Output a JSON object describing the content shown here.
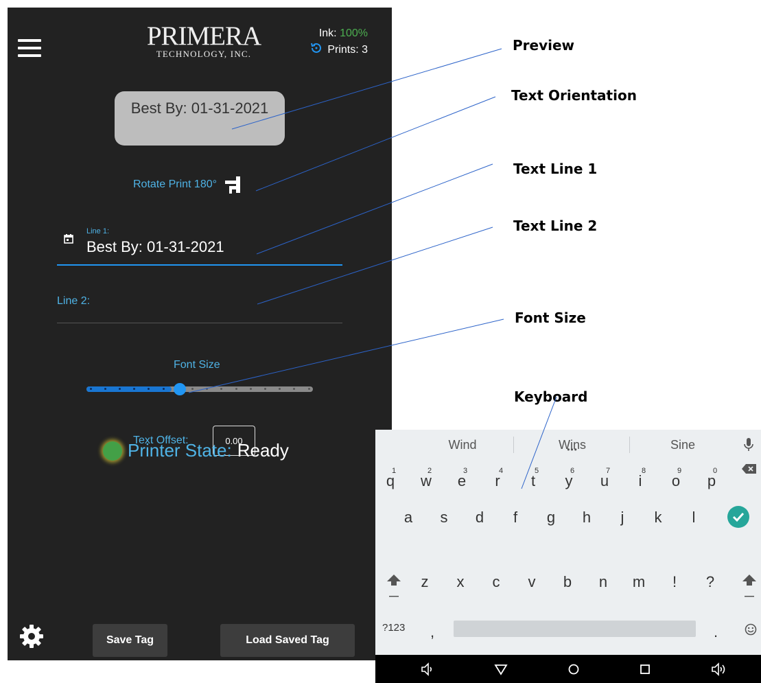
{
  "app": {
    "logo_main": "PRIMERA",
    "logo_sub": "TECHNOLOGY, INC.",
    "ink_label": "Ink:",
    "ink_value": "100%",
    "prints_label": "Prints: 3",
    "preview_text": "Best By: 01-31-2021",
    "rotate_label": "Rotate Print 180°",
    "line1_label": "Line 1:",
    "line1_value": "Best By: 01-31-2021",
    "line2_label": "Line 2:",
    "font_size_label": "Font Size",
    "font_size_level": 0.375,
    "text_offset_label": "Text Offset:",
    "text_offset_value": "0.00",
    "printer_state_label": "Printer State:",
    "printer_state_value": "Ready",
    "save_button": "Save Tag",
    "load_button": "Load Saved Tag",
    "colors": {
      "accent": "#4fb3e6",
      "ink": "#4caf50",
      "state_dot": "#43a047",
      "background": "#222222"
    }
  },
  "annotations": {
    "preview": "Preview",
    "text_orientation": "Text Orientation",
    "text_line_1": "Text Line 1",
    "text_line_2": "Text Line 2",
    "font_size": "Font Size",
    "keyboard": "Keyboard"
  },
  "keyboard": {
    "suggestions": [
      "Wind",
      "Wins",
      "Sine"
    ],
    "row1": [
      "q",
      "w",
      "e",
      "r",
      "t",
      "y",
      "u",
      "i",
      "o",
      "p"
    ],
    "row1_hints": [
      "1",
      "2",
      "3",
      "4",
      "5",
      "6",
      "7",
      "8",
      "9",
      "0"
    ],
    "row2": [
      "a",
      "s",
      "d",
      "f",
      "g",
      "h",
      "j",
      "k",
      "l"
    ],
    "row3": [
      "z",
      "x",
      "c",
      "v",
      "b",
      "n",
      "m",
      "!",
      "?"
    ],
    "symbols_key": "?123",
    "comma": ",",
    "period": ".",
    "icons": [
      "mic-icon",
      "backspace-icon",
      "enter-check-icon",
      "shift-icon",
      "emoji-icon"
    ]
  },
  "nav_bar": {
    "icons": [
      "volume-down-icon",
      "back-icon",
      "home-icon",
      "recents-icon",
      "volume-up-icon"
    ]
  }
}
